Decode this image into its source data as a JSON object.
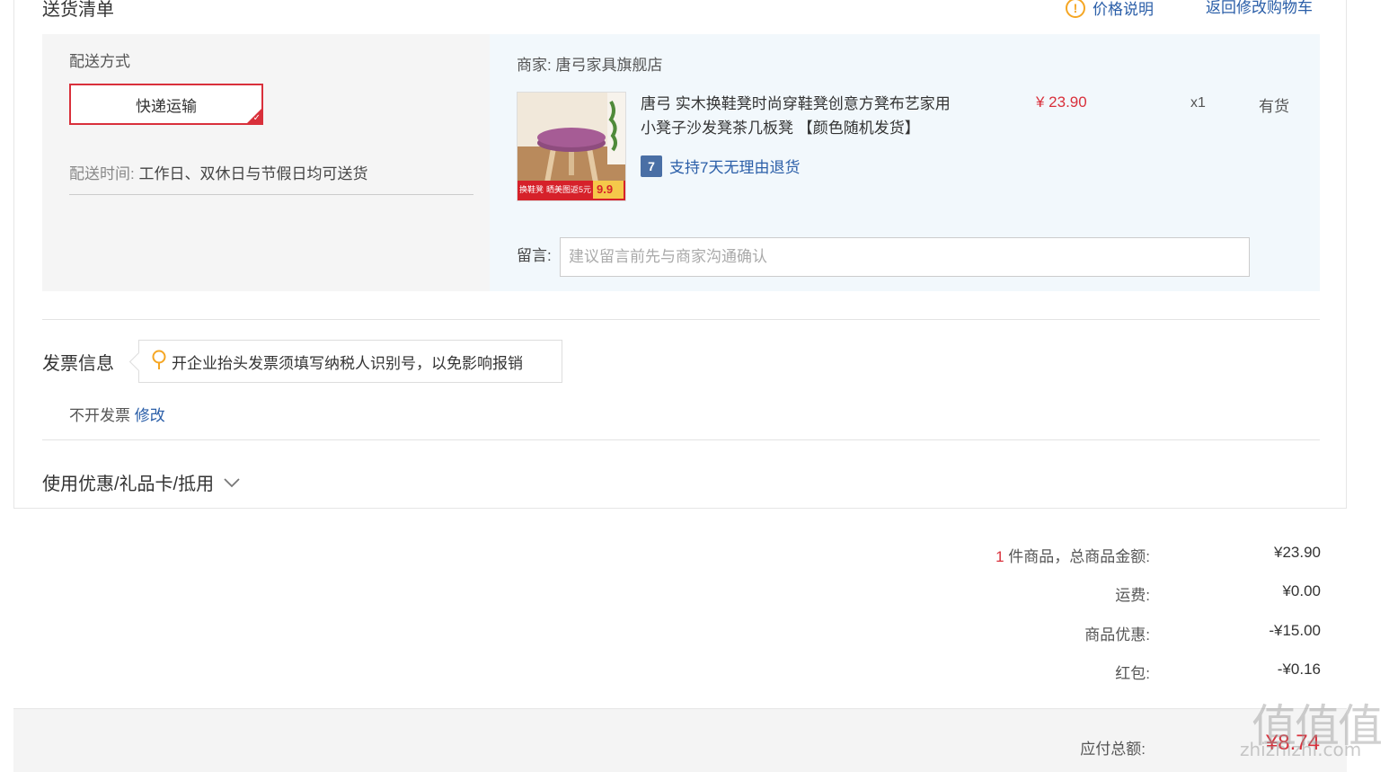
{
  "section": {
    "title": "送货清单",
    "price_note": "价格说明",
    "back_link": "返回修改购物车"
  },
  "shipping": {
    "method_label": "配送方式",
    "method_value": "快递运输",
    "time_label": "配送时间:",
    "time_value": "工作日、双休日与节假日均可送货"
  },
  "product": {
    "merchant_label": "商家:",
    "merchant_name": "唐弓家具旗舰店",
    "name": "唐弓 实木换鞋凳时尚穿鞋凳创意方凳布艺家用小凳子沙发凳茶几板凳 【颜色随机发货】",
    "price": "¥ 23.90",
    "qty": "x1",
    "stock": "有货",
    "return_policy": "支持7天无理由退货",
    "return_badge": "7",
    "thumb_banner_left": "换鞋凳",
    "thumb_banner_mid": "晒美图返5元",
    "thumb_banner_price": "9.9"
  },
  "message": {
    "label": "留言:",
    "placeholder": "建议留言前先与商家沟通确认",
    "value": ""
  },
  "invoice": {
    "title": "发票信息",
    "tip": "开企业抬头发票须填写纳税人识别号，以免影响报销",
    "status": "不开发票",
    "edit": "修改"
  },
  "coupon": {
    "label": "使用优惠/礼品卡/抵用"
  },
  "summary": {
    "count": "1",
    "items_label": "件商品，总商品金额:",
    "items_total": "¥23.90",
    "shipping_label": "运费:",
    "shipping_value": "¥0.00",
    "discount_label": "商品优惠:",
    "discount_value": "-¥15.00",
    "redpacket_label": "红包:",
    "redpacket_value": "-¥0.16",
    "payable_label": "应付总额:",
    "payable_value": "¥8.74"
  },
  "watermark": {
    "logo": "值值值",
    "site": "zhizhizhi.com"
  },
  "colors": {
    "accent_red": "#d9303b",
    "link_blue": "#2a5ea8",
    "warn_orange": "#f5a623"
  }
}
